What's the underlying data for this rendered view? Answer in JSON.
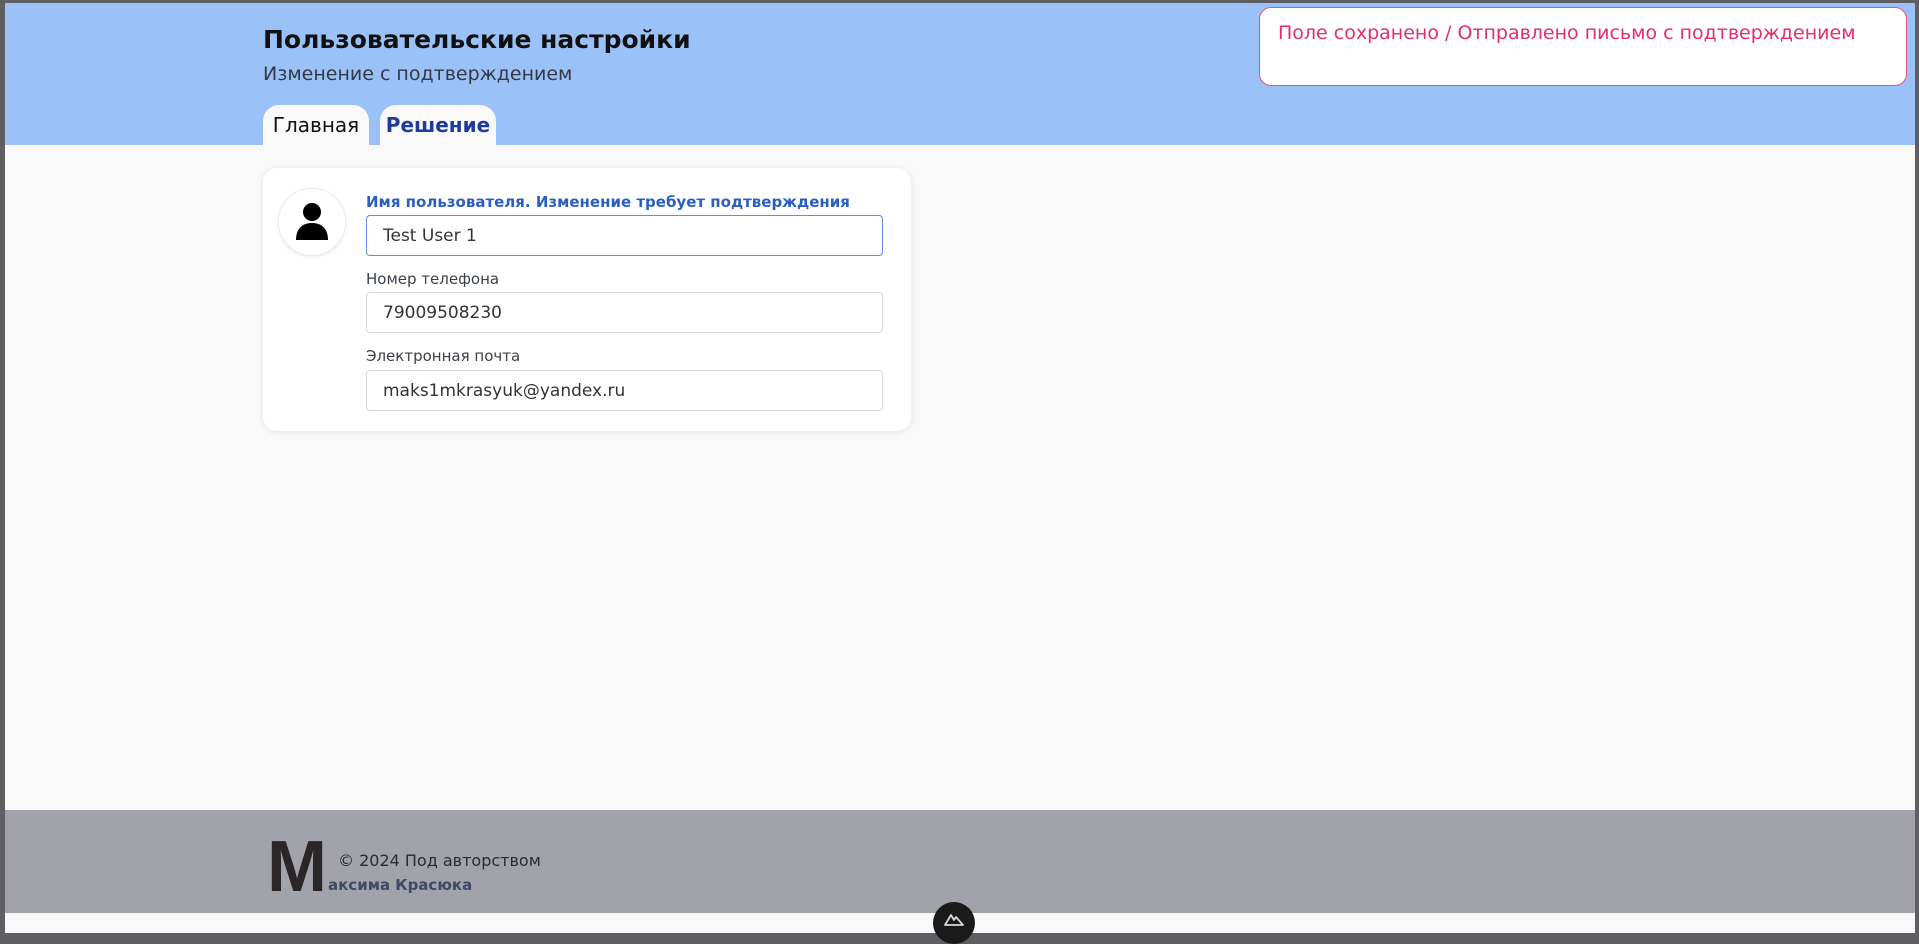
{
  "header": {
    "title": "Пользовательские настройки",
    "subtitle": "Изменение с подтверждением",
    "tabs": [
      {
        "label": "Главная",
        "active": true
      },
      {
        "label": "Решение",
        "active": false
      }
    ]
  },
  "toast": {
    "message": "Поле сохранено / Отправлено письмо с подтверждением"
  },
  "profile": {
    "avatar_icon": "user-icon",
    "fields": [
      {
        "label": "Имя пользователя. Изменение требует подтверждения",
        "value": "Test User 1",
        "focused": true
      },
      {
        "label": "Номер телефона",
        "value": "79009508230",
        "focused": false
      },
      {
        "label": "Электронная почта",
        "value": "maks1mkrasyuk@yandex.ru",
        "focused": false
      }
    ]
  },
  "footer": {
    "logo_letter": "M",
    "copyright": "© 2024 Под авторством",
    "author": "аксима Красюка"
  },
  "colors": {
    "header_bg": "#9ac2f8",
    "toast_accent": "#e62c6c",
    "active_label": "#2a5fbf",
    "footer_bg": "#a2a2aa"
  },
  "dev_badge_icon": "nuxt-icon"
}
